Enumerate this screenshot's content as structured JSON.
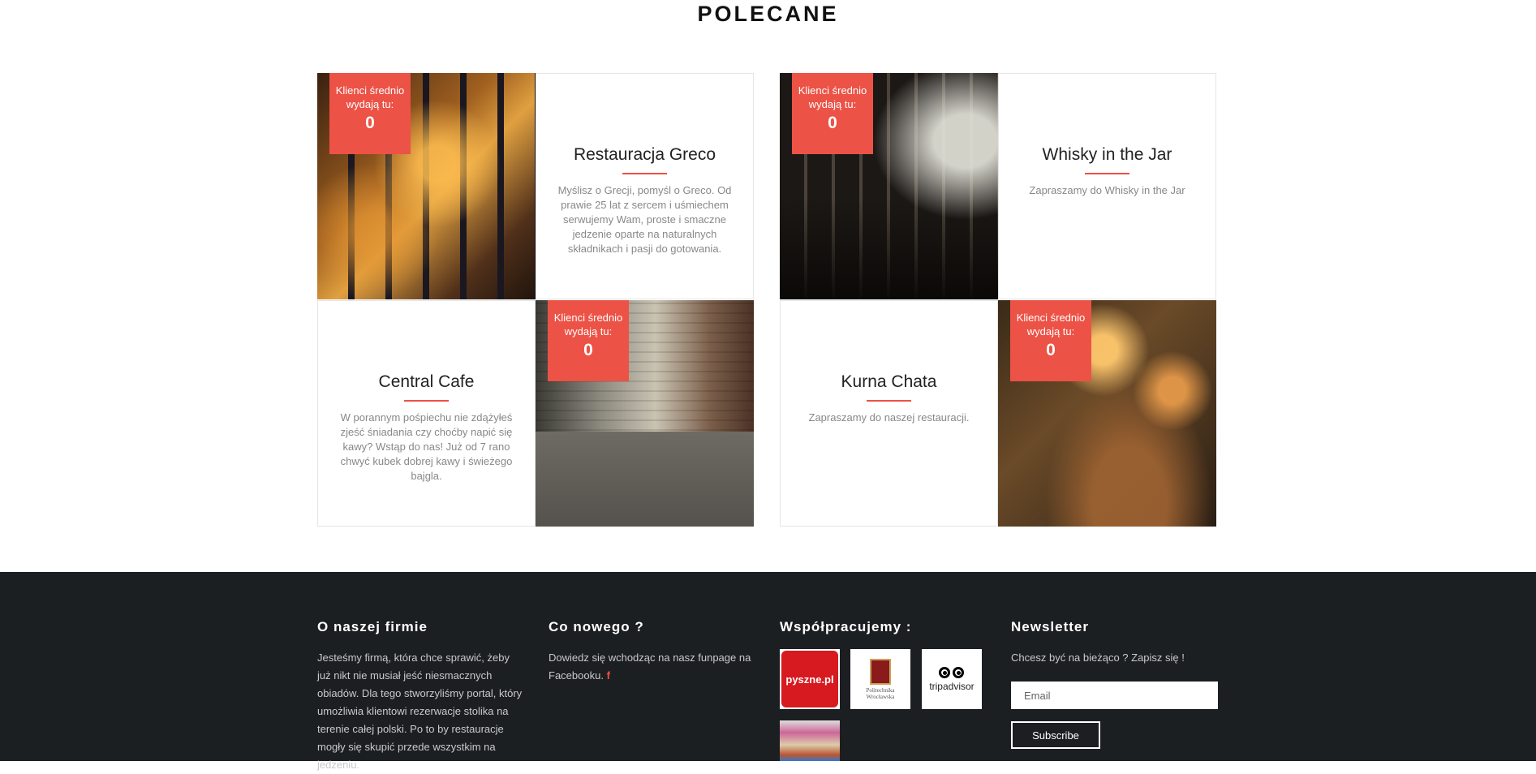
{
  "section_title": "POLECANE",
  "badge": {
    "label_line1": "Klienci średnio",
    "label_line2": "wydają tu:"
  },
  "restaurants": [
    {
      "name": "Restauracja Greco",
      "spend": "0",
      "description": "Myślisz o Grecji, pomyśl o Greco. Od prawie 25 lat z sercem i uśmiechem serwujemy Wam, proste i smaczne jedzenie oparte na naturalnych składnikach i pasji do gotowania."
    },
    {
      "name": "Whisky in the Jar",
      "spend": "0",
      "description": "Zapraszamy do Whisky in the Jar"
    },
    {
      "name": "Central Cafe",
      "spend": "0",
      "description": "W porannym pośpiechu nie zdążyłeś zjeść śniadania czy choćby napić się kawy? Wstąp do nas! Już od 7 rano chwyć kubek dobrej kawy i świeżego bajgla."
    },
    {
      "name": "Kurna Chata",
      "spend": "0",
      "description": "Zapraszamy do naszej restauracji."
    }
  ],
  "footer": {
    "about": {
      "title": "O naszej firmie",
      "text": "Jesteśmy firmą, która chce sprawić, żeby już nikt nie musiał jeść niesmacznych obiadów. Dla tego stworzyliśmy portal, który umożliwia klientowi rezerwacje stolika na terenie całej polski. Po to by restauracje mogły się skupić przede wszystkim na jedzeniu."
    },
    "news": {
      "title": "Co nowego ?",
      "text": "Dowiedz się wchodząc na nasz funpage na Facebooku.",
      "fb_icon": "f"
    },
    "partners": {
      "title": "Współpracujemy :",
      "pyszne": "pyszne.pl",
      "pwr_line1": "Politechnika",
      "pwr_line2": "Wrocławska",
      "trip": "tripadvisor"
    },
    "newsletter": {
      "title": "Newsletter",
      "text": "Chcesz być na bieżąco ? Zapisz się !",
      "email_placeholder": "Email",
      "subscribe_label": "Subscribe"
    }
  },
  "colors": {
    "accent": "#ec5246",
    "footer_bg": "#1c1f22"
  }
}
